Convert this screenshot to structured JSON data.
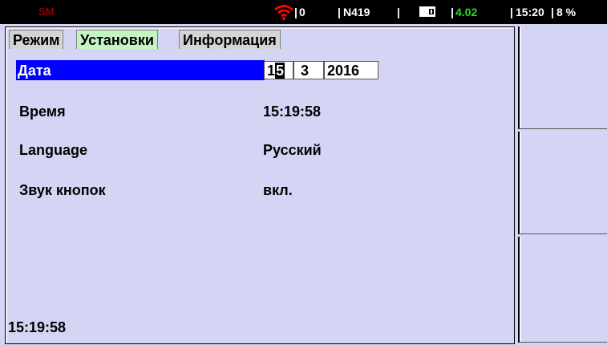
{
  "status_bar": {
    "mode": "SM",
    "signal_value": "0",
    "station": "N419",
    "voltage": "4.02",
    "time": "15:20",
    "battery_percent": "8 %",
    "separator": "|",
    "colors": {
      "mode": "#8b0000",
      "wifi": "#ff0000",
      "voltage": "#22dd22"
    }
  },
  "tabs": [
    {
      "label": "Режим",
      "active": false
    },
    {
      "label": "Установки",
      "active": true
    },
    {
      "label": "Информация",
      "active": false
    }
  ],
  "settings": {
    "date": {
      "label": "Дата",
      "day_first_digit": "1",
      "day_cursor_digit": "5",
      "month": "3",
      "year": "2016"
    },
    "time": {
      "label": "Время",
      "value": "15:19:58"
    },
    "language": {
      "label": "Language",
      "value": "Русский"
    },
    "key_sound": {
      "label": "Звук кнопок",
      "value": "вкл."
    }
  },
  "footer": {
    "clock": "15:19:58"
  },
  "softkeys": [
    "",
    "",
    ""
  ],
  "colors": {
    "selection": "#0000ff",
    "active_tab": "#c4f4c4",
    "panel": "#d4d4f4"
  }
}
